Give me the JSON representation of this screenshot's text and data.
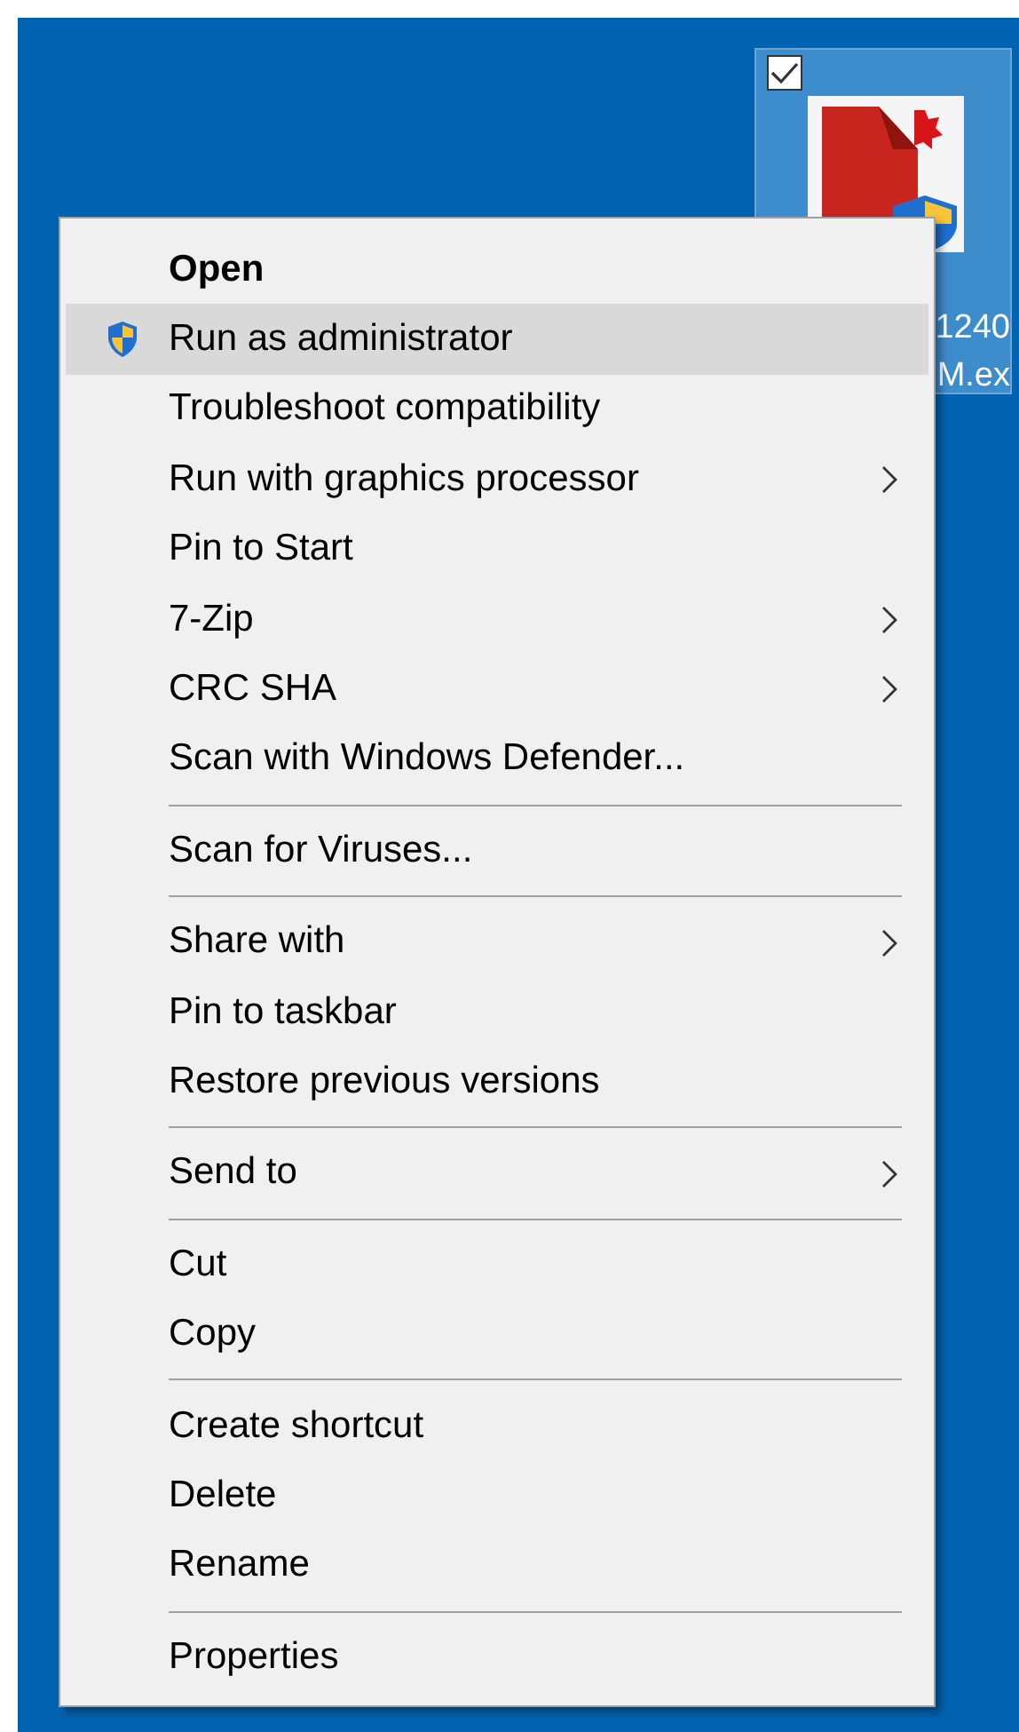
{
  "desktop_icon": {
    "checked": true,
    "selected": true,
    "label_lines": [
      "1240",
      "M.ex"
    ]
  },
  "context_menu": {
    "groups": [
      {
        "items": [
          {
            "label": "Open",
            "bold": true,
            "selected": false,
            "submenu": false,
            "kind": "plain"
          },
          {
            "label": "Run as administrator",
            "bold": false,
            "selected": true,
            "submenu": false,
            "kind": "shield"
          },
          {
            "label": "Troubleshoot compatibility",
            "bold": false,
            "selected": false,
            "submenu": false,
            "kind": "plain"
          },
          {
            "label": "Run with graphics processor",
            "bold": false,
            "selected": false,
            "submenu": true,
            "kind": "plain"
          },
          {
            "label": "Pin to Start",
            "bold": false,
            "selected": false,
            "submenu": false,
            "kind": "plain"
          },
          {
            "label": "7-Zip",
            "bold": false,
            "selected": false,
            "submenu": true,
            "kind": "plain"
          },
          {
            "label": "CRC SHA",
            "bold": false,
            "selected": false,
            "submenu": true,
            "kind": "plain"
          },
          {
            "label": "Scan with Windows Defender...",
            "bold": false,
            "selected": false,
            "submenu": false,
            "kind": "plain"
          }
        ]
      },
      {
        "items": [
          {
            "label": "Scan for Viruses...",
            "bold": false,
            "selected": false,
            "submenu": false,
            "kind": "plain"
          }
        ]
      },
      {
        "items": [
          {
            "label": "Share with",
            "bold": false,
            "selected": false,
            "submenu": true,
            "kind": "plain"
          },
          {
            "label": "Pin to taskbar",
            "bold": false,
            "selected": false,
            "submenu": false,
            "kind": "plain"
          },
          {
            "label": "Restore previous versions",
            "bold": false,
            "selected": false,
            "submenu": false,
            "kind": "plain"
          }
        ]
      },
      {
        "items": [
          {
            "label": "Send to",
            "bold": false,
            "selected": false,
            "submenu": true,
            "kind": "plain"
          }
        ]
      },
      {
        "items": [
          {
            "label": "Cut",
            "bold": false,
            "selected": false,
            "submenu": false,
            "kind": "plain"
          },
          {
            "label": "Copy",
            "bold": false,
            "selected": false,
            "submenu": false,
            "kind": "plain"
          }
        ]
      },
      {
        "items": [
          {
            "label": "Create shortcut",
            "bold": false,
            "selected": false,
            "submenu": false,
            "kind": "plain"
          },
          {
            "label": "Delete",
            "bold": false,
            "selected": false,
            "submenu": false,
            "kind": "plain"
          },
          {
            "label": "Rename",
            "bold": false,
            "selected": false,
            "submenu": false,
            "kind": "plain"
          }
        ]
      },
      {
        "items": [
          {
            "label": "Properties",
            "bold": false,
            "selected": false,
            "submenu": false,
            "kind": "plain"
          }
        ]
      }
    ]
  }
}
